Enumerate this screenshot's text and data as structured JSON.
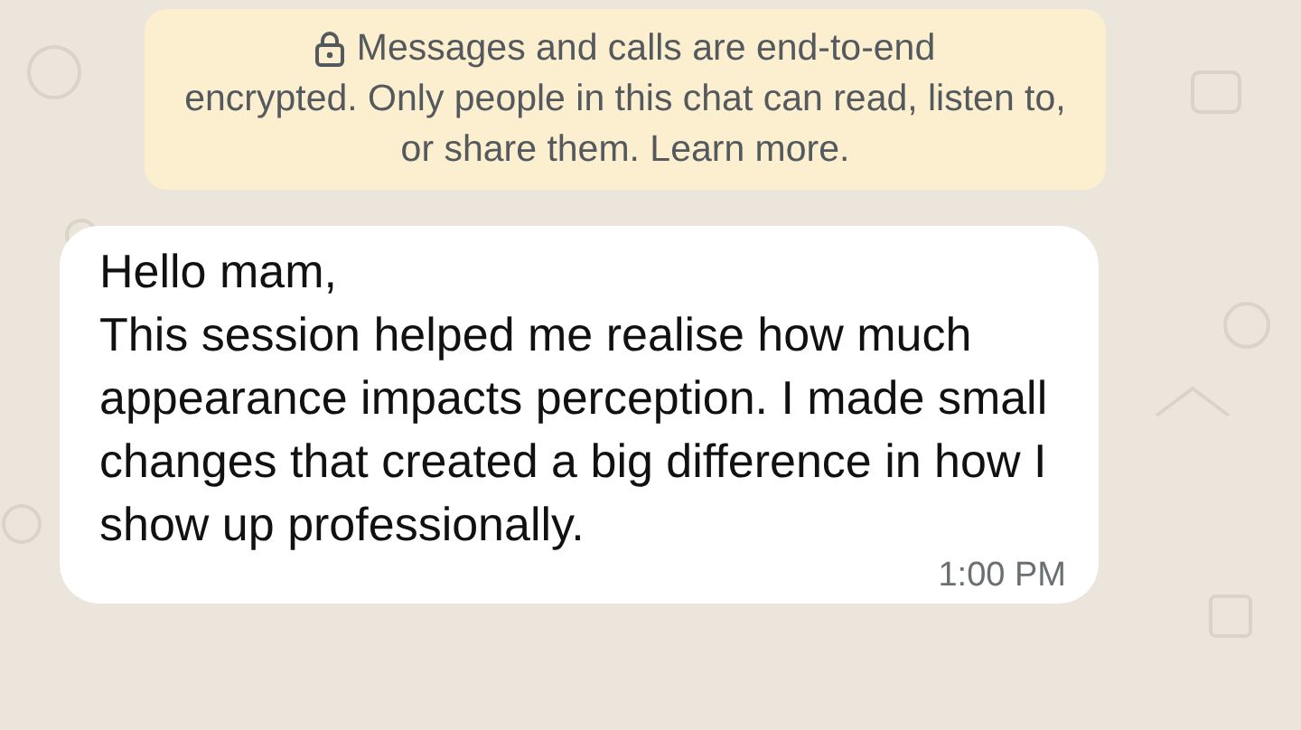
{
  "encryption_notice": {
    "first_line": "Messages and calls are end-to-end",
    "text": "encrypted. Only people in this chat can read, listen to, or share them.",
    "link": "Learn more."
  },
  "messages": [
    {
      "kind": "incoming",
      "text": "Hello mam,\nThis session helped me realise how much appearance impacts perception. I made small changes that created a big difference in how I show up professionally.",
      "time": "1:00 PM"
    }
  ]
}
